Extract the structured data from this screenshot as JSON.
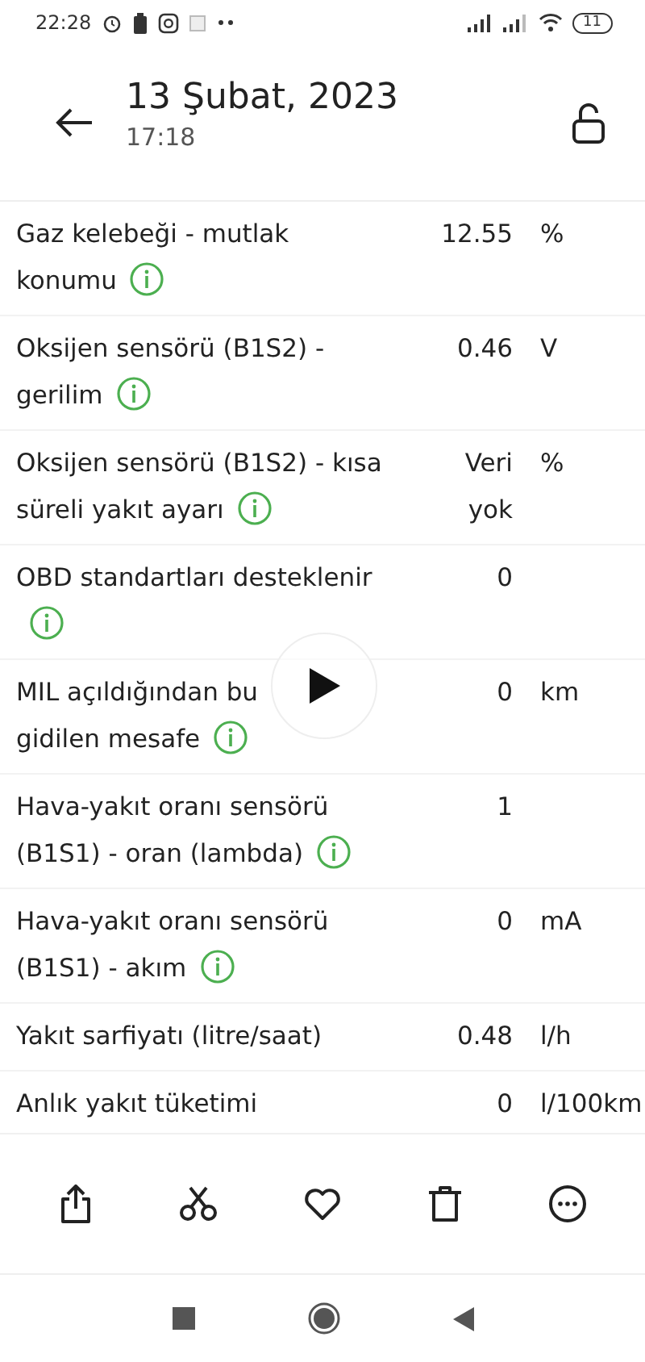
{
  "status_bar": {
    "time": "22:28",
    "battery": "11"
  },
  "header": {
    "title": "13 Şubat, 2023",
    "subtitle": "17:18"
  },
  "rows": [
    {
      "label": "Gaz kelebeği - mutlak\nkonumu",
      "value": "12.55",
      "unit": "%"
    },
    {
      "label": "Oksijen sensörü (B1S2) -\ngerilim",
      "value": "0.46",
      "unit": "V"
    },
    {
      "label": "Oksijen sensörü (B1S2) - kısa\nsüreli yakıt ayarı",
      "value": "Veri\nyok",
      "unit": "%"
    },
    {
      "label": "OBD standartları desteklenir\n",
      "value": "0"
    },
    {
      "label": "MIL açıldığından bu\ngidilen mesafe",
      "value": "0",
      "unit": "km"
    },
    {
      "label": "Hava-yakıt oranı sensörü\n(B1S1) - oran (lambda)",
      "value": "1"
    },
    {
      "label": "Hava-yakıt oranı sensörü\n(B1S1) - akım",
      "value": "0",
      "unit": "mA"
    },
    {
      "label": "Yakıt sarfiyatı (litre/saat)",
      "value": "0.48",
      "unit": "l/h",
      "info": false
    },
    {
      "label": "Anlık yakıt tüketimi",
      "value": "0",
      "unit": "l/100km",
      "info": false
    }
  ],
  "toolbar": [
    {
      "kind": "share"
    },
    {
      "kind": "cut"
    },
    {
      "kind": "favorite"
    },
    {
      "kind": "delete"
    },
    {
      "kind": "more"
    }
  ]
}
